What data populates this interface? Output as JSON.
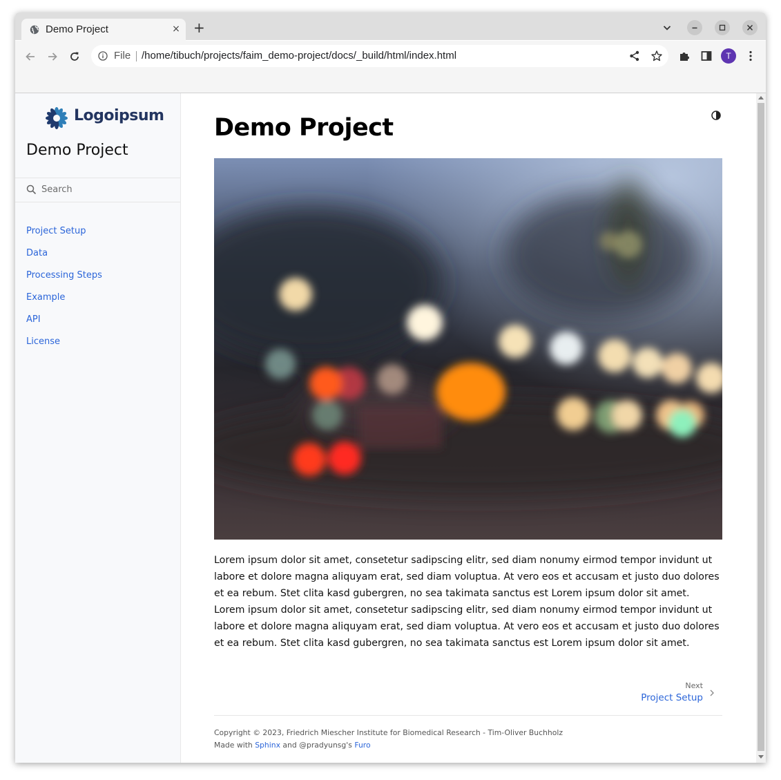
{
  "browser": {
    "tab_title": "Demo Project",
    "tab_close": "×",
    "new_tab": "+",
    "omnibox_file": "File",
    "omnibox_url": "/home/tibuch/projects/faim_demo-project/docs/_build/html/index.html",
    "avatar_letter": "T",
    "icons": [
      "globe-icon",
      "close-icon",
      "plus-icon",
      "chevron-down-icon",
      "minimize-icon",
      "maximize-icon",
      "close-window-icon",
      "back-icon",
      "forward-icon",
      "reload-icon",
      "info-icon",
      "share-icon",
      "star-icon",
      "extensions-icon",
      "side-panel-icon",
      "more-vert-icon"
    ]
  },
  "sidebar": {
    "logo_text": "Logoipsum",
    "title": "Demo Project",
    "search_placeholder": "Search",
    "items": [
      {
        "label": "Project Setup"
      },
      {
        "label": "Data"
      },
      {
        "label": "Processing Steps"
      },
      {
        "label": "Example"
      },
      {
        "label": "API"
      },
      {
        "label": "License"
      }
    ]
  },
  "main": {
    "title": "Demo Project",
    "paragraph": "Lorem ipsum dolor sit amet, consetetur sadipscing elitr, sed diam nonumy eirmod tempor invidunt ut labore et dolore magna aliquyam erat, sed diam voluptua. At vero eos et accusam et justo duo dolores et ea rebum. Stet clita kasd gubergren, no sea takimata sanctus est Lorem ipsum dolor sit amet. Lorem ipsum dolor sit amet, consetetur sadipscing elitr, sed diam nonumy eirmod tempor invidunt ut labore et dolore magna aliquyam erat, sed diam voluptua. At vero eos et accusam et justo duo dolores et ea rebum. Stet clita kasd gubergren, no sea takimata sanctus est Lorem ipsum dolor sit amet.",
    "next_label": "Next",
    "next_title": "Project Setup"
  },
  "footer": {
    "copyright": "Copyright © 2023, Friedrich Miescher Institute for Biomedical Research - Tim-Oliver Buchholz",
    "made_with_prefix": "Made with ",
    "sphinx": "Sphinx",
    "and_text": " and @pradyunsg's ",
    "furo": "Furo"
  },
  "colors": {
    "link": "#2b65d9",
    "sidebar_bg": "#f8f9fb",
    "logo": "#233560",
    "avatar": "#5e35b1"
  }
}
